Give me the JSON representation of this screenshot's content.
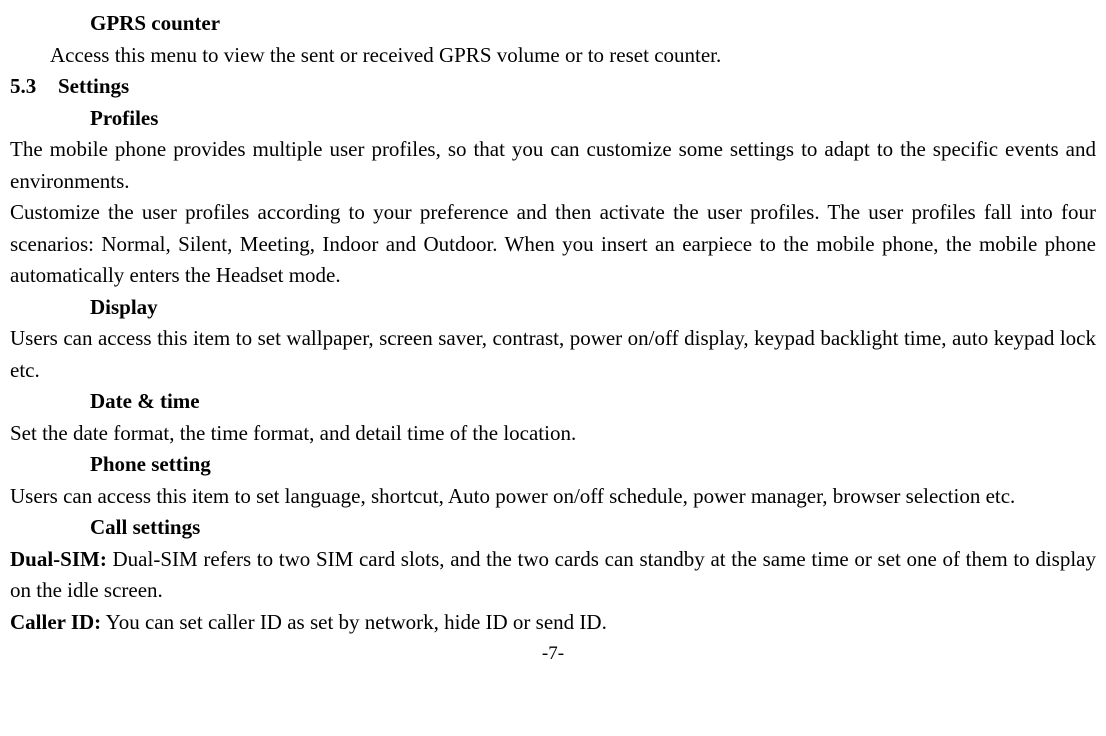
{
  "gprs": {
    "heading": "GPRS counter",
    "text": "Access this menu to view the sent or received GPRS volume or to reset counter."
  },
  "section": {
    "num": "5.3",
    "title": "Settings"
  },
  "profiles": {
    "heading": "Profiles",
    "p1": "The mobile phone provides multiple user profiles, so that you can customize some settings to adapt to the specific events and environments.",
    "p2": "Customize the user profiles according to your preference and then activate the user profiles. The user profiles fall into four scenarios: Normal, Silent, Meeting, Indoor and Outdoor. When you insert an earpiece to the mobile phone, the mobile phone automatically enters the Headset mode."
  },
  "display": {
    "heading": "Display",
    "text": "Users can access this item to set wallpaper, screen saver, contrast, power on/off display, keypad backlight time, auto keypad lock etc."
  },
  "datetime": {
    "heading": "Date & time",
    "text": "Set the date format, the time format, and detail time of the location."
  },
  "phonesetting": {
    "heading": "Phone setting",
    "text": "Users can access this item to set language, shortcut, Auto power on/off schedule, power manager, browser selection etc."
  },
  "callsettings": {
    "heading": "Call settings",
    "dualsim_label": "Dual-SIM:",
    "dualsim_text": " Dual-SIM refers to two SIM card slots, and the two cards can standby at the same time or set one of them to display on the idle screen.",
    "callerid_label": "Caller ID:",
    "callerid_text": " You can set caller ID as set by network, hide ID or send ID."
  },
  "footer": "-7-"
}
